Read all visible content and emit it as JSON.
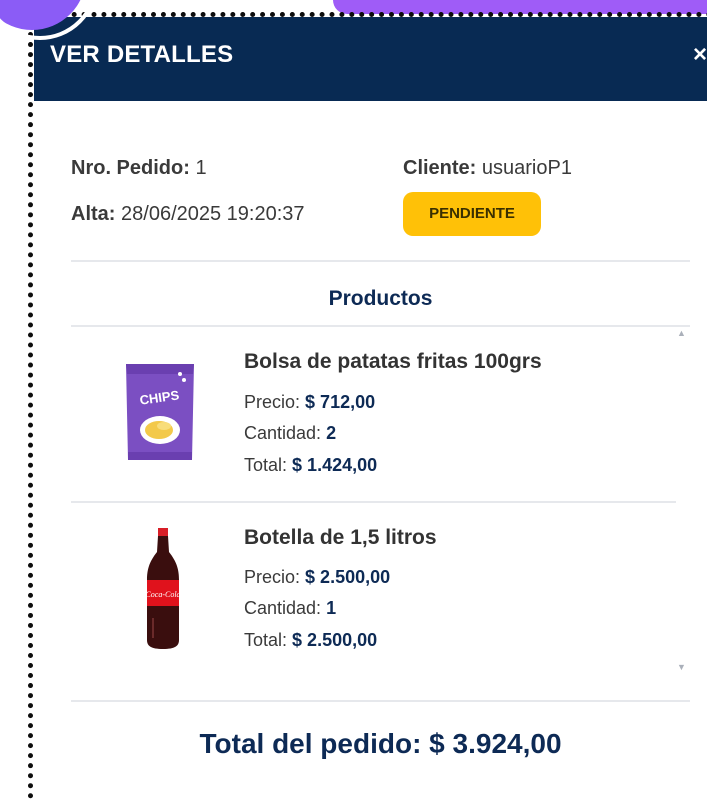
{
  "modal": {
    "title": "VER DETALLES",
    "close_symbol": "×"
  },
  "order": {
    "number_label": "Nro. Pedido:",
    "number": "1",
    "client_label": "Cliente:",
    "client": "usuarioP1",
    "created_label": "Alta:",
    "created": "28/06/2025 19:20:37",
    "status": "PENDIENTE",
    "status_color": "#ffc107"
  },
  "products_title": "Productos",
  "products": [
    {
      "name": "Bolsa de patatas fritas 100grs",
      "price_label": "Precio:",
      "price": "$ 712,00",
      "qty_label": "Cantidad:",
      "qty": "2",
      "total_label": "Total:",
      "total": "$ 1.424,00",
      "image_text": "CHIPS",
      "icon": "chips-bag-icon"
    },
    {
      "name": "Botella de 1,5 litros",
      "price_label": "Precio:",
      "price": "$ 2.500,00",
      "qty_label": "Cantidad:",
      "qty": "1",
      "total_label": "Total:",
      "total": "$ 2.500,00",
      "image_text": "Coca-Cola",
      "icon": "soda-bottle-icon"
    }
  ],
  "order_total": "Total del pedido: $ 3.924,00",
  "colors": {
    "header": "#082a53",
    "accent": "#0d2a55",
    "decor_purple": "#9f5cf7"
  }
}
